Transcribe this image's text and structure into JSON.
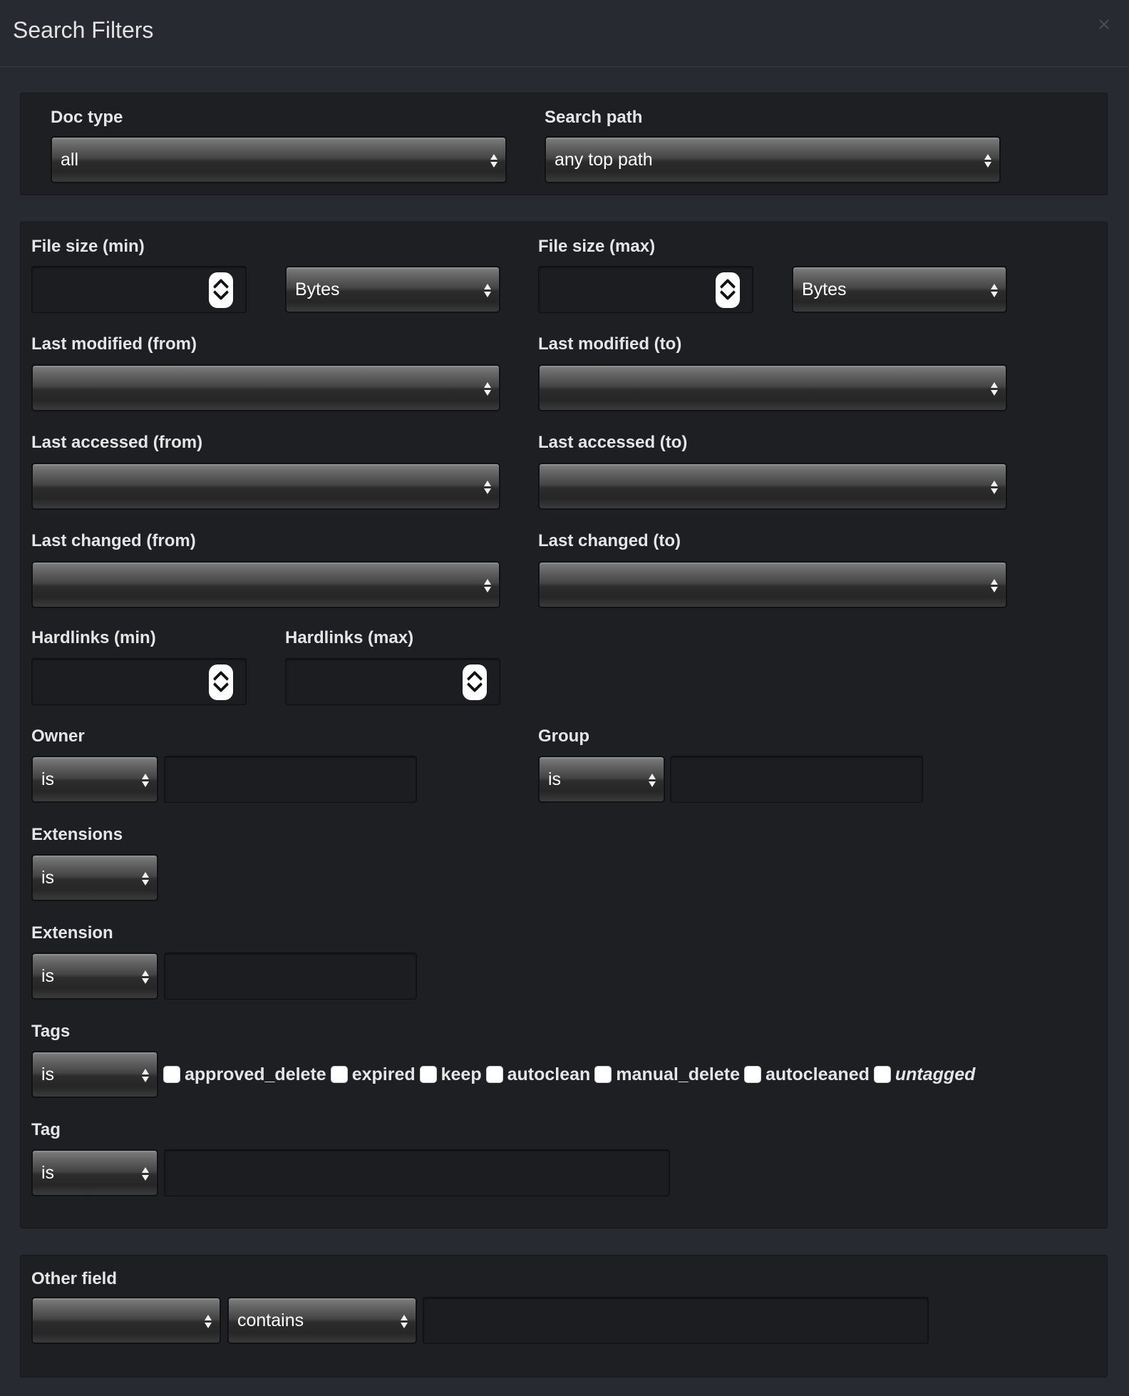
{
  "modal": {
    "title": "Search Filters",
    "close": "×"
  },
  "panel1": {
    "doc_type": {
      "label": "Doc type",
      "value": "all"
    },
    "search_path": {
      "label": "Search path",
      "value": "any top path"
    }
  },
  "panel2": {
    "file_size_min": {
      "label": "File size (min)",
      "value": "",
      "unit": "Bytes"
    },
    "file_size_max": {
      "label": "File size (max)",
      "value": "",
      "unit": "Bytes"
    },
    "last_modified_from": {
      "label": "Last modified (from)",
      "value": ""
    },
    "last_modified_to": {
      "label": "Last modified (to)",
      "value": ""
    },
    "last_accessed_from": {
      "label": "Last accessed (from)",
      "value": ""
    },
    "last_accessed_to": {
      "label": "Last accessed (to)",
      "value": ""
    },
    "last_changed_from": {
      "label": "Last changed (from)",
      "value": ""
    },
    "last_changed_to": {
      "label": "Last changed (to)",
      "value": ""
    },
    "hardlinks_min": {
      "label": "Hardlinks (min)",
      "value": ""
    },
    "hardlinks_max": {
      "label": "Hardlinks (max)",
      "value": ""
    },
    "owner": {
      "label": "Owner",
      "operator": "is",
      "value": ""
    },
    "group": {
      "label": "Group",
      "operator": "is",
      "value": ""
    },
    "extensions": {
      "label": "Extensions",
      "operator": "is"
    },
    "extension": {
      "label": "Extension",
      "operator": "is",
      "value": ""
    },
    "tags": {
      "label": "Tags",
      "operator": "is",
      "items": [
        "approved_delete",
        "expired",
        "keep",
        "autoclean",
        "manual_delete",
        "autocleaned",
        "untagged"
      ]
    },
    "tag": {
      "label": "Tag",
      "operator": "is",
      "value": ""
    }
  },
  "panel3": {
    "other_field": {
      "label": "Other field",
      "field": "",
      "operator": "contains",
      "value": ""
    }
  }
}
